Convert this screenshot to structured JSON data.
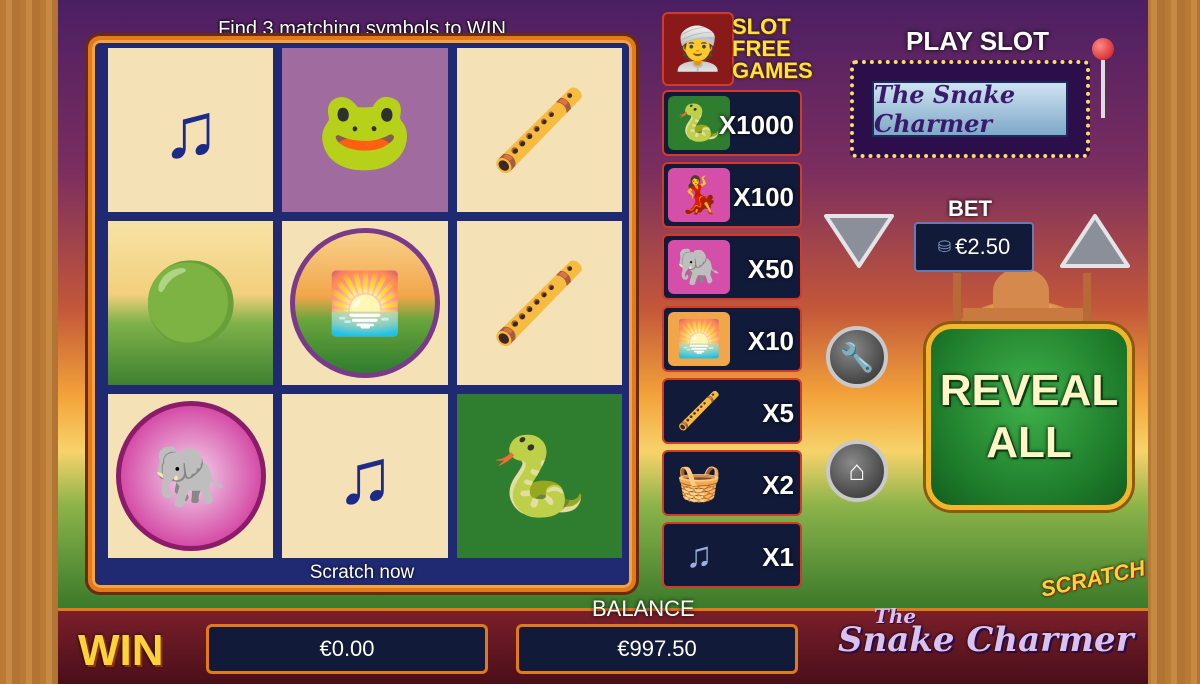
{
  "instruction": "Find 3 matching symbols to WIN",
  "grid": [
    {
      "symbol": "music-notes",
      "glyph": "♫"
    },
    {
      "symbol": "cobra",
      "glyph": "🐸"
    },
    {
      "symbol": "flute",
      "glyph": "🪈"
    },
    {
      "symbol": "cobra",
      "glyph": "🟢"
    },
    {
      "symbol": "landscape",
      "glyph": "🌅"
    },
    {
      "symbol": "flute",
      "glyph": "🪈"
    },
    {
      "symbol": "elephant",
      "glyph": "🐘"
    },
    {
      "symbol": "music-notes",
      "glyph": "♫"
    },
    {
      "symbol": "cobra",
      "glyph": "🐍"
    }
  ],
  "scratch_now": "Scratch now",
  "free_games": {
    "line1": "SLOT",
    "line2": "FREE",
    "line3": "GAMES",
    "icon": "snake-charmer-icon"
  },
  "paytable": [
    {
      "symbol": "cobra",
      "glyph": "🐍",
      "multiplier": "X1000"
    },
    {
      "symbol": "dancer",
      "glyph": "💃",
      "multiplier": "X100"
    },
    {
      "symbol": "elephant",
      "glyph": "🐘",
      "multiplier": "X50"
    },
    {
      "symbol": "landscape",
      "glyph": "🌅",
      "multiplier": "X10"
    },
    {
      "symbol": "flute",
      "glyph": "🪈",
      "multiplier": "X5"
    },
    {
      "symbol": "basket",
      "glyph": "🧺",
      "multiplier": "X2"
    },
    {
      "symbol": "music-notes",
      "glyph": "♫",
      "multiplier": "X1"
    }
  ],
  "play_slot": {
    "label": "PLAY SLOT",
    "logo_text": "The Snake Charmer"
  },
  "bet": {
    "label": "BET",
    "value": "€2.50"
  },
  "reveal_all": "REVEAL\nALL",
  "win": {
    "label": "WIN",
    "value": "€0.00"
  },
  "balance": {
    "label": "BALANCE",
    "value": "€997.50"
  },
  "footer_logo": {
    "scratch": "SCRATCH",
    "the": "The",
    "name": "Snake Charmer"
  },
  "colors": {
    "accent_orange": "#e07a1a",
    "reveal_green": "#1d7a2a",
    "win_gold": "#ffd23a"
  }
}
